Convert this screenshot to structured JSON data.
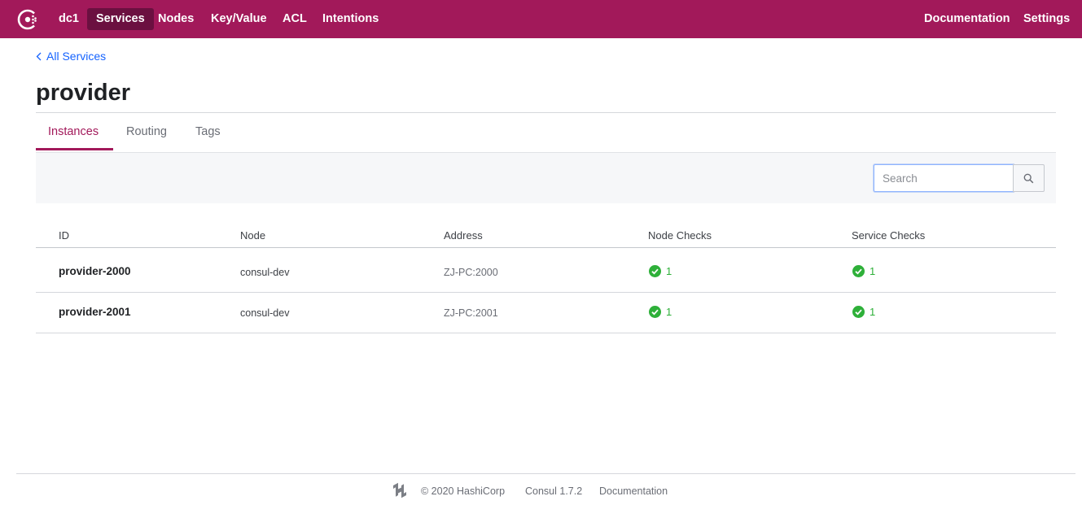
{
  "header": {
    "datacenter": "dc1",
    "nav": [
      "Services",
      "Nodes",
      "Key/Value",
      "ACL",
      "Intentions"
    ],
    "active_nav": "Services",
    "right_nav": [
      "Documentation",
      "Settings"
    ],
    "brand_color": "#a2195a",
    "active_color": "#6b1040"
  },
  "breadcrumb": {
    "label": "All Services",
    "icon": "chevron-left-icon"
  },
  "page": {
    "title": "provider"
  },
  "tabs": [
    {
      "label": "Instances",
      "active": true
    },
    {
      "label": "Routing",
      "active": false
    },
    {
      "label": "Tags",
      "active": false
    }
  ],
  "search": {
    "placeholder": "Search",
    "value": "",
    "icon": "search-icon"
  },
  "table": {
    "columns": [
      "ID",
      "Node",
      "Address",
      "Node Checks",
      "Service Checks"
    ],
    "rows": [
      {
        "id": "provider-2000",
        "node": "consul-dev",
        "address": "ZJ-PC:2000",
        "node_checks": "1",
        "service_checks": "1"
      },
      {
        "id": "provider-2001",
        "node": "consul-dev",
        "address": "ZJ-PC:2001",
        "node_checks": "1",
        "service_checks": "1"
      }
    ],
    "check_icon": "check-circle-icon",
    "check_color": "#2eb039"
  },
  "footer": {
    "copyright": "© 2020 HashiCorp",
    "version": "Consul 1.7.2",
    "docs": "Documentation",
    "logo_icon": "hashicorp-logo-icon"
  }
}
